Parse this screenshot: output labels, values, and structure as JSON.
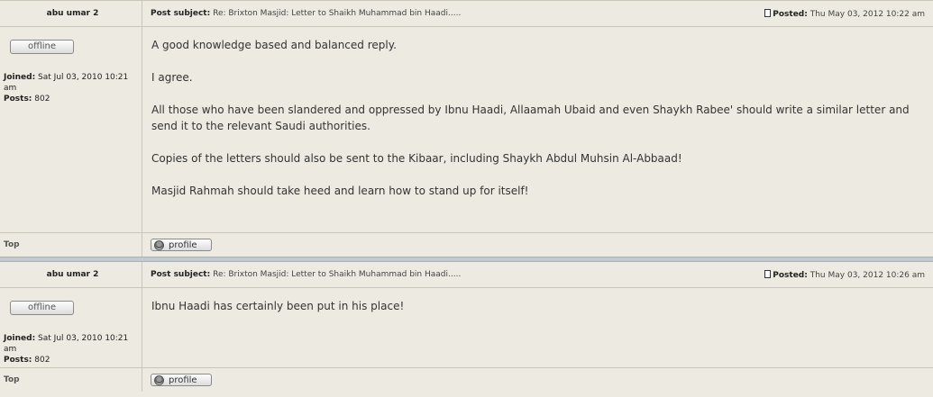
{
  "posts": [
    {
      "author": "abu umar 2",
      "subject_label": "Post subject:",
      "subject": "Re: Brixton Masjid: Letter to Shaikh Muhammad bin Haadi.....",
      "posted_label": "Posted:",
      "posted": "Thu May 03, 2012 10:22 am",
      "status": "offline",
      "joined_label": "Joined:",
      "joined": "Sat Jul 03, 2010 10:21 am",
      "posts_label": "Posts:",
      "post_count": "802",
      "body": [
        "A good knowledge based and balanced reply.",
        "I agree.",
        "All those who have been slandered and oppressed by Ibnu Haadi, Allaamah Ubaid and even Shaykh Rabee' should write a similar letter and send it to the relevant Saudi authorities.",
        "Copies of the letters should also be sent to the Kibaar, including Shaykh Abdul Muhsin Al-Abbaad!",
        "Masjid Rahmah should take heed and learn how to stand up for itself!"
      ],
      "top_label": "Top",
      "profile_label": "profile"
    },
    {
      "author": "abu umar 2",
      "subject_label": "Post subject:",
      "subject": "Re: Brixton Masjid: Letter to Shaikh Muhammad bin Haadi.....",
      "posted_label": "Posted:",
      "posted": "Thu May 03, 2012 10:26 am",
      "status": "offline",
      "joined_label": "Joined:",
      "joined": "Sat Jul 03, 2010 10:21 am",
      "posts_label": "Posts:",
      "post_count": "802",
      "body": [
        "Ibnu Haadi has certainly been put in his place!"
      ],
      "top_label": "Top",
      "profile_label": "profile"
    }
  ],
  "icons": {
    "post": "post-icon",
    "profile": "profile-icon"
  }
}
